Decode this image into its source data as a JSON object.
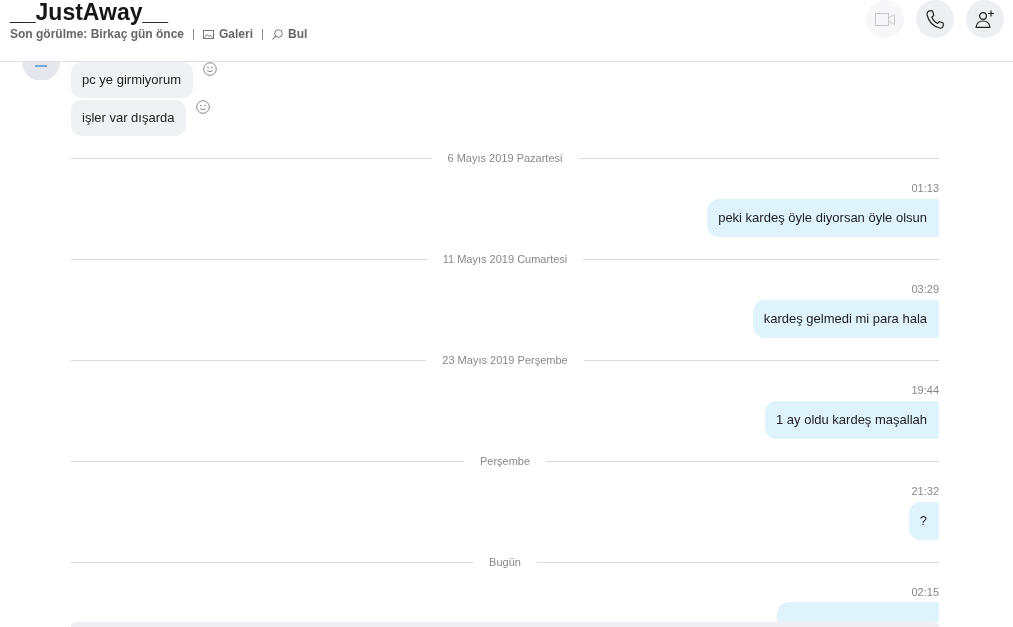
{
  "header": {
    "title": "__JustAway__",
    "status": "Son görülme: Birkaç gün önce",
    "links": [
      {
        "kind": "gallery",
        "label": "Galeri"
      },
      {
        "kind": "search",
        "label": "Bul"
      }
    ],
    "actions": [
      {
        "kind": "video",
        "disabled": true
      },
      {
        "kind": "call",
        "disabled": false
      },
      {
        "kind": "add_person",
        "disabled": false
      }
    ]
  },
  "conversation": {
    "items": [
      {
        "kind": "incoming_group",
        "messages": [
          {
            "text": "pc ye girmiyorum"
          },
          {
            "text": "işler var dışarda"
          }
        ]
      },
      {
        "kind": "date",
        "label": "6 Mayıs 2019 Pazartesi"
      },
      {
        "kind": "outgoing",
        "time": "01:13",
        "text": "peki kardeş öyle diyorsan öyle olsun"
      },
      {
        "kind": "date",
        "label": "11 Mayıs 2019 Cumartesi"
      },
      {
        "kind": "outgoing",
        "time": "03:29",
        "text": "kardeş gelmedi mi para hala"
      },
      {
        "kind": "date",
        "label": "23 Mayıs 2019 Perşembe"
      },
      {
        "kind": "outgoing",
        "time": "19:44",
        "text": "1 ay oldu kardeş maşallah"
      },
      {
        "kind": "date",
        "label": "Perşembe"
      },
      {
        "kind": "outgoing",
        "time": "21:32",
        "text": "?"
      },
      {
        "kind": "date",
        "label": "Bugün"
      },
      {
        "kind": "outgoing",
        "time": "02:15"
      }
    ]
  }
}
